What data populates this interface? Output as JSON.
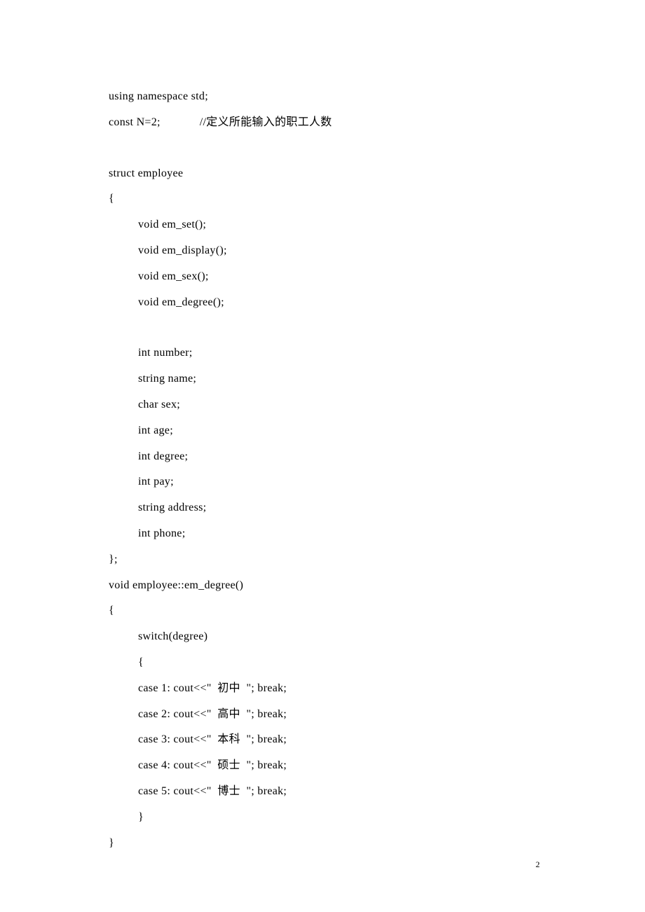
{
  "lines": {
    "l1a": "using namespace std;",
    "l1b": "const N=2;             //定义所能输入的职工人数",
    "l2": "struct employee",
    "l3": "{",
    "l4": "void em_set();",
    "l5": "void em_display();",
    "l6": "void em_sex();",
    "l7": "void em_degree();",
    "l8": "int number;",
    "l9": "string name;",
    "l10": "char sex;",
    "l11": "int age;",
    "l12": "int degree;",
    "l13": "int pay;",
    "l14": "string address;",
    "l15": "int phone;",
    "l16": "};",
    "l17": "void employee::em_degree()",
    "l18": "{",
    "l19": "switch(degree)",
    "l20": "{",
    "l21": "case 1: cout<<\"  初中  \"; break;",
    "l22": "case 2: cout<<\"  高中  \"; break;",
    "l23": "case 3: cout<<\"  本科  \"; break;",
    "l24": "case 4: cout<<\"  硕士  \"; break;",
    "l25": "case 5: cout<<\"  博士  \"; break;",
    "l26": "}",
    "l27": "}"
  },
  "pageNumber": "2"
}
